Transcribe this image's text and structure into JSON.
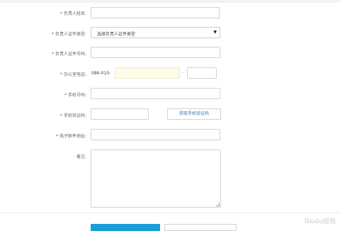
{
  "form": {
    "fields": [
      {
        "label": "负责人姓名:",
        "required": true
      },
      {
        "label": "负责人证件类型:",
        "required": true,
        "selected": "选择负责人证件类型"
      },
      {
        "label": "负责人证件号码:",
        "required": true
      },
      {
        "label": "办公室电话:",
        "required": true,
        "prefix": "086-010-",
        "separator": "-"
      },
      {
        "label": "手机号码:",
        "required": true
      },
      {
        "label": "手机验证码:",
        "required": true,
        "action": "获取手机验证码"
      },
      {
        "label": "电子邮件地址:",
        "required": true
      },
      {
        "label": "备注:",
        "required": false
      }
    ],
    "required_mark": "*"
  },
  "watermark": "Baidu经验",
  "colors": {
    "primary": "#1a9ed8",
    "link": "#3b78b8",
    "required": "#e23333"
  }
}
